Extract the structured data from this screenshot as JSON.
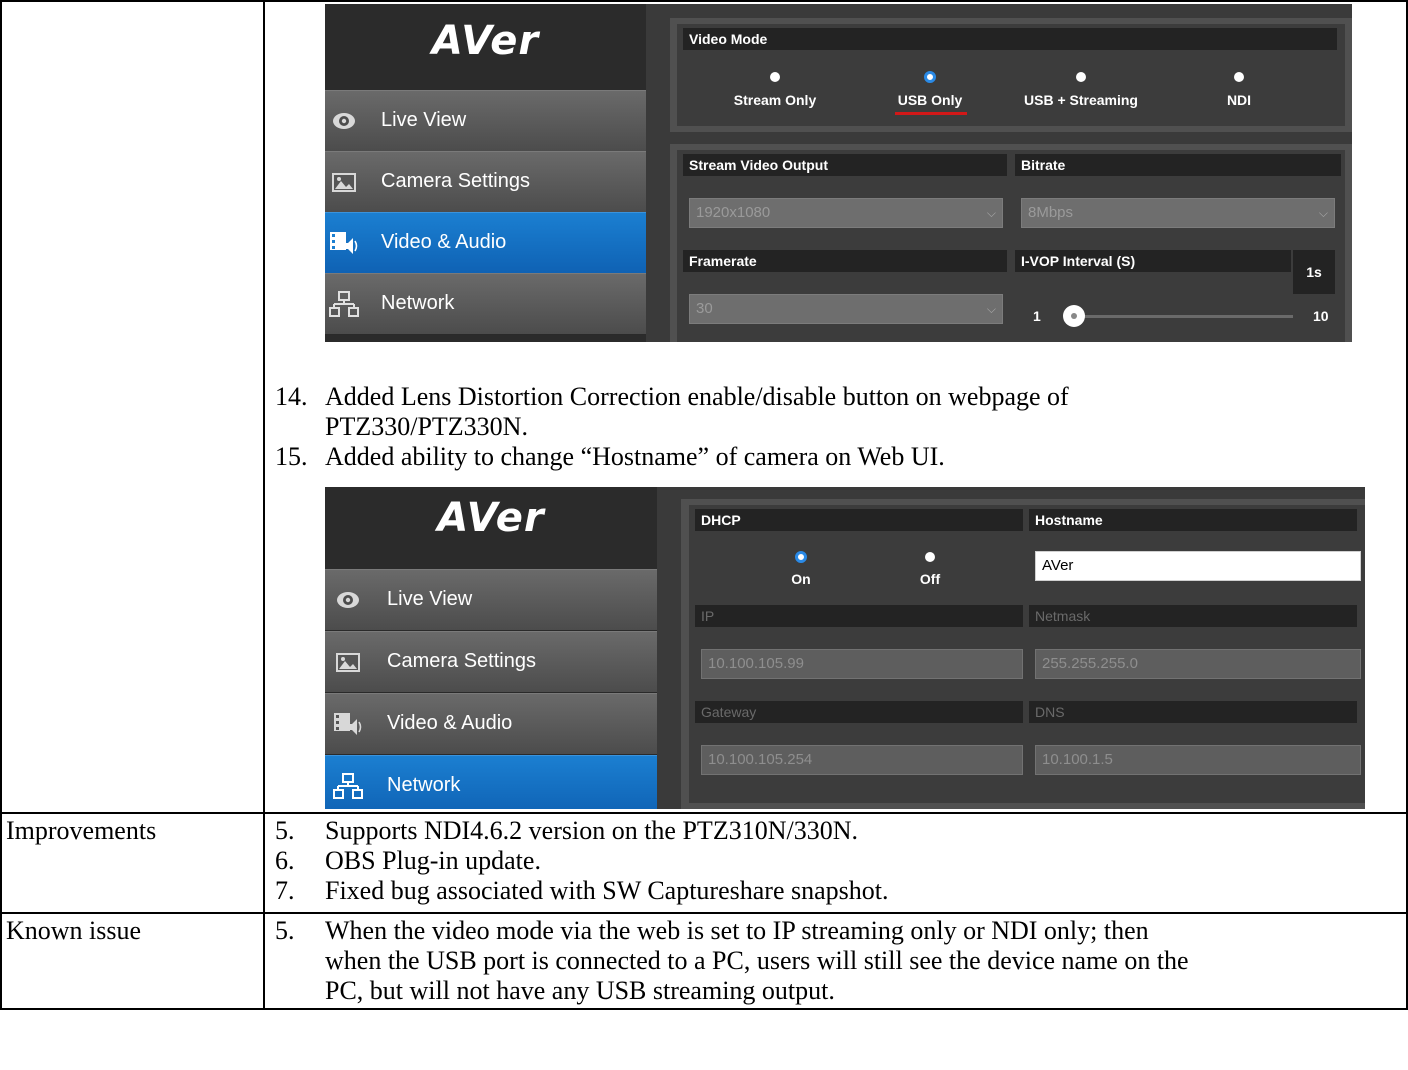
{
  "screenshot1": {
    "logo": "AVer",
    "nav": [
      {
        "label": "Live View",
        "icon": "eye-icon",
        "active": false
      },
      {
        "label": "Camera Settings",
        "icon": "picture-icon",
        "active": false
      },
      {
        "label": "Video & Audio",
        "icon": "video-audio-icon",
        "active": true
      },
      {
        "label": "Network",
        "icon": "network-icon",
        "active": false
      }
    ],
    "video_mode": {
      "title": "Video Mode",
      "options": [
        "Stream Only",
        "USB Only",
        "USB + Streaming",
        "NDI"
      ],
      "selected": "USB Only"
    },
    "stream_video_output": {
      "title": "Stream Video Output",
      "value": "1920x1080"
    },
    "bitrate": {
      "title": "Bitrate",
      "value": "8Mbps"
    },
    "framerate": {
      "title": "Framerate",
      "value": "30"
    },
    "ivop": {
      "title": "I-VOP Interval (S)",
      "current": "1s",
      "min": "1",
      "max": "10",
      "value": 1
    }
  },
  "items_mid": [
    {
      "num": "14.",
      "lines": [
        "Added Lens Distortion Correction enable/disable button on webpage of",
        "PTZ330/PTZ330N."
      ]
    },
    {
      "num": "15.",
      "lines": [
        "Added ability to change “Hostname” of camera on Web UI."
      ]
    }
  ],
  "screenshot2": {
    "logo": "AVer",
    "nav": [
      {
        "label": "Live View",
        "icon": "eye-icon",
        "active": false
      },
      {
        "label": "Camera Settings",
        "icon": "picture-icon",
        "active": false
      },
      {
        "label": "Video & Audio",
        "icon": "video-audio-icon",
        "active": false
      },
      {
        "label": "Network",
        "icon": "network-icon",
        "active": true
      }
    ],
    "dhcp": {
      "title": "DHCP",
      "options": [
        "On",
        "Off"
      ],
      "selected": "On"
    },
    "hostname": {
      "title": "Hostname",
      "value": "AVer"
    },
    "ip": {
      "title": "IP",
      "value": "10.100.105.99"
    },
    "netmask": {
      "title": "Netmask",
      "value": "255.255.255.0"
    },
    "gateway": {
      "title": "Gateway",
      "value": "10.100.105.254"
    },
    "dns": {
      "title": "DNS",
      "value": "10.100.1.5"
    }
  },
  "rows": [
    {
      "label": "Improvements",
      "items": [
        {
          "num": "5.",
          "lines": [
            "Supports NDI4.6.2 version on the PTZ310N/330N."
          ]
        },
        {
          "num": "6.",
          "lines": [
            "OBS Plug-in update."
          ]
        },
        {
          "num": "7.",
          "lines": [
            "Fixed bug associated with SW Captureshare snapshot."
          ]
        }
      ]
    },
    {
      "label": "Known issue",
      "items": [
        {
          "num": "5.",
          "lines": [
            "When the video mode via the web is set to IP streaming only or NDI only; then",
            "when the USB port is connected to a PC, users will still see the device name on the",
            "PC, but will not have any USB streaming output."
          ]
        }
      ]
    }
  ],
  "colors": {
    "active_nav": "#1b7fd1",
    "radio_selected": "#2a8ae6",
    "underline": "#d21818"
  }
}
